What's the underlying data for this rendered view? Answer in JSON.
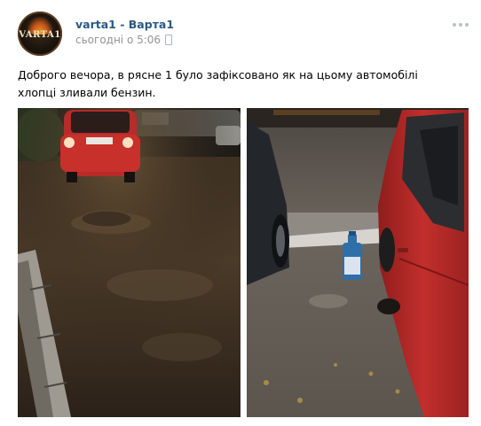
{
  "post": {
    "author_name": "varta1",
    "author_separator": "-",
    "author_group": "Варта1",
    "timestamp": "сьогодні о 5:06",
    "text": "Доброго вечора, в рясне 1 було зафіксовано як на цьому автомобілі хлопці зливали бензин.",
    "avatar_text": "VARTA1",
    "icons": {
      "device": "mobile-device-icon",
      "more": "more-dots-icon"
    },
    "colors": {
      "author_link": "#2a5885",
      "meta_text": "#939393",
      "car_red": "#c12a2a"
    },
    "photos": [
      {
        "label": "night-street-red-car"
      },
      {
        "label": "parking-red-car-bottle"
      }
    ]
  }
}
